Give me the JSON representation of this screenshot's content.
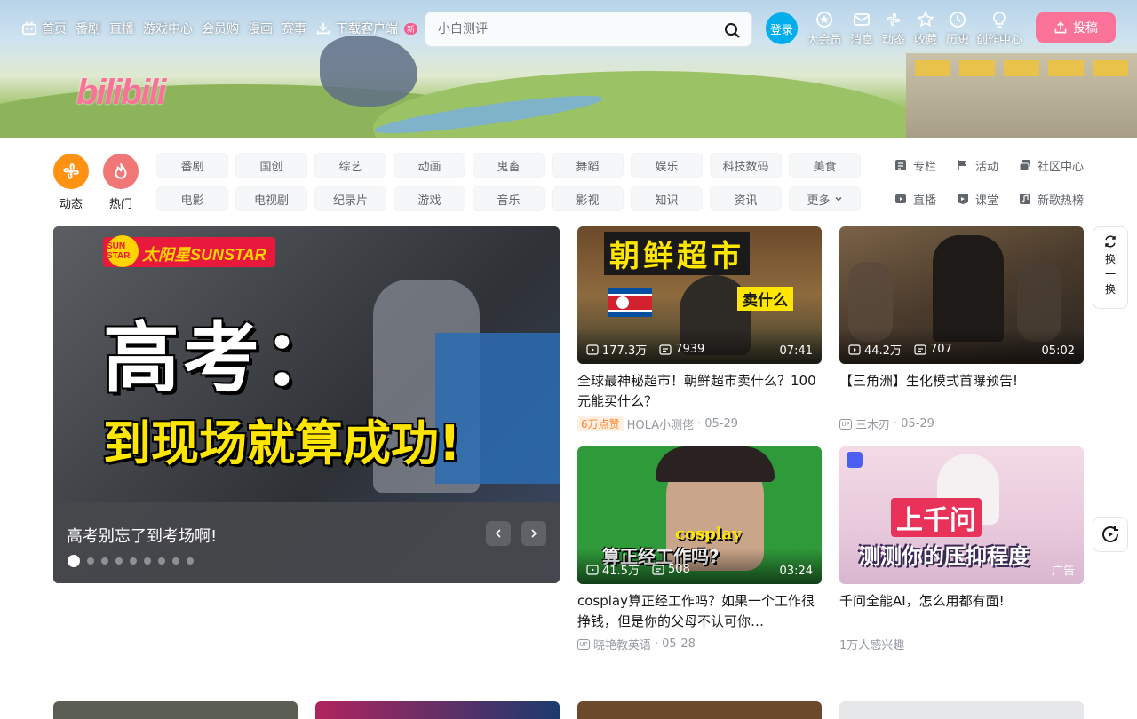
{
  "header": {
    "logo": "bilibili",
    "nav_left": [
      {
        "label": "首页",
        "icon": "tv-icon"
      },
      {
        "label": "番剧"
      },
      {
        "label": "直播"
      },
      {
        "label": "游戏中心"
      },
      {
        "label": "会员购"
      },
      {
        "label": "漫画"
      },
      {
        "label": "赛事"
      },
      {
        "label": "下载客户端",
        "icon": "download-icon",
        "badge": "新"
      }
    ],
    "search_placeholder": "小白测评",
    "login_label": "登录",
    "nav_right": [
      {
        "label": "大会员",
        "icon": "vip-icon"
      },
      {
        "label": "消息",
        "icon": "message-icon"
      },
      {
        "label": "动态",
        "icon": "dynamic-icon"
      },
      {
        "label": "收藏",
        "icon": "star-icon"
      },
      {
        "label": "历史",
        "icon": "clock-icon"
      },
      {
        "label": "创作中心",
        "icon": "bulb-icon"
      }
    ],
    "upload_label": "投稿"
  },
  "channels": {
    "icons": [
      {
        "label": "动态",
        "color": "#ff9212"
      },
      {
        "label": "热门",
        "color": "#f07775"
      }
    ],
    "tags": [
      "番剧",
      "国创",
      "综艺",
      "动画",
      "鬼畜",
      "舞蹈",
      "娱乐",
      "科技数码",
      "美食",
      "电影",
      "电视剧",
      "纪录片",
      "游戏",
      "音乐",
      "影视",
      "知识",
      "资讯",
      "更多"
    ],
    "side_links": [
      {
        "label": "专栏",
        "icon": "column-icon"
      },
      {
        "label": "活动",
        "icon": "flag-icon"
      },
      {
        "label": "社区中心",
        "icon": "community-icon"
      },
      {
        "label": "直播",
        "icon": "live-icon"
      },
      {
        "label": "课堂",
        "icon": "class-icon"
      },
      {
        "label": "新歌热榜",
        "icon": "music-icon"
      }
    ]
  },
  "carousel": {
    "brand": "太阳星SUNSTAR",
    "brand_star": "SUN STAR",
    "headline": "高考：",
    "subline": "到现场就算成功!",
    "title": "高考别忘了到考场啊!",
    "slide_count": 9,
    "active_index": 0
  },
  "videos": [
    {
      "thumb_text": "朝鲜超市",
      "thumb_sub": "卖什么",
      "plays": "177.3万",
      "danmaku": "7939",
      "duration": "07:41",
      "title": "全球最神秘超市！朝鲜超市卖什么？100元能买什么？",
      "badge": "6万点赞",
      "author": "HOLA小测佬",
      "date": "05-29"
    },
    {
      "thumb_text": "",
      "plays": "44.2万",
      "danmaku": "707",
      "duration": "05:02",
      "title": "【三角洲】生化模式首曝预告!",
      "author": "三木刃",
      "date": "05-29"
    },
    {
      "thumb_text": "cosplay",
      "thumb_sub": "算正经工作吗?",
      "plays": "41.5万",
      "danmaku": "508",
      "duration": "03:24",
      "title": "cosplay算正经工作吗？如果一个工作很挣钱，但是你的父母不认可你…",
      "author": "晓艳教英语",
      "date": "05-28"
    },
    {
      "thumb_text": "上千问",
      "thumb_sub": "测测你的压抑程度",
      "ad_label": "广告",
      "title": "千问全能AI，怎么用都有面!",
      "interest": "1万人感兴趣"
    }
  ],
  "float": {
    "refresh_label": [
      "换",
      "一",
      "换"
    ]
  },
  "colors": {
    "brand_pink": "#fb7299",
    "brand_blue": "#00aeec",
    "text_main": "#18191c",
    "text_sub": "#9499a0"
  }
}
